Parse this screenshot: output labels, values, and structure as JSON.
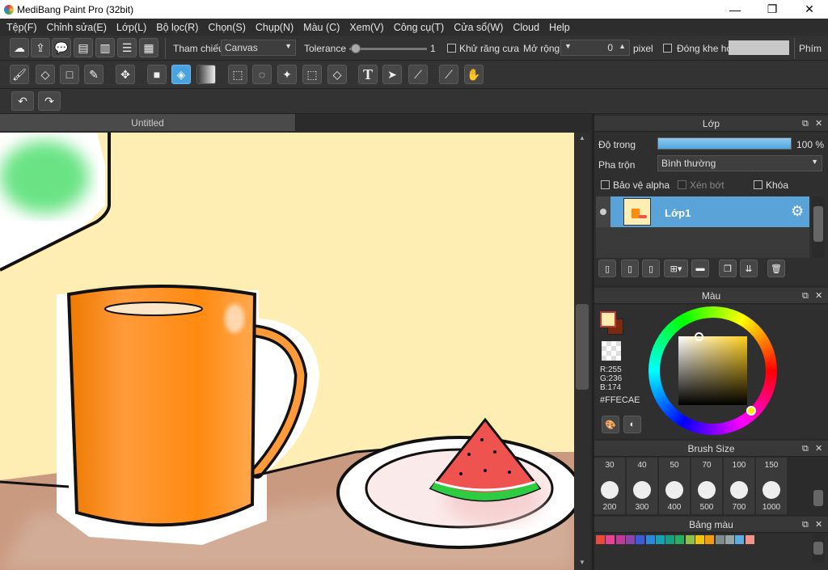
{
  "app": {
    "title": "MediBang Paint Pro (32bit)",
    "min": "—",
    "max": "❐",
    "close": "✕"
  },
  "menu": [
    "Tệp(F)",
    "Chỉnh sửa(E)",
    "Lớp(L)",
    "Bộ lọc(R)",
    "Chọn(S)",
    "Chụp(N)",
    "Màu (C)",
    "Xem(V)",
    "Công cụ(T)",
    "Cửa sổ(W)",
    "Cloud",
    "Help"
  ],
  "toolbar": {
    "reference_label": "Tham chiếu",
    "reference_value": "Canvas",
    "tolerance_label": "Tolerance",
    "tolerance_value": "1",
    "tolerance_fraction": 0.02,
    "antialias_label": "Khử răng cưa",
    "expand_label": "Mở rộng",
    "expand_value": "0",
    "pixel_label": "pixel",
    "close_gap_label": "Đóng khe hở",
    "keys_label": "Phím"
  },
  "document": {
    "tab": "Untitled"
  },
  "layers": {
    "title": "Lớp",
    "opacity_label": "Độ trong",
    "opacity_value": "100 %",
    "opacity_fraction": 1.0,
    "blend_label": "Pha trộn",
    "blend_value": "Bình thường",
    "protect_alpha": "Bảo vệ alpha",
    "clip": "Xén bớt",
    "lock": "Khóa",
    "layer_name": "Lớp1"
  },
  "color": {
    "title": "Màu",
    "r": "R:255",
    "g": "G:236",
    "b": "B:174",
    "hex": "#FFECAE",
    "fg": "#FFECAE",
    "bg": "#7a2a10"
  },
  "brush": {
    "title": "Brush Size",
    "top": [
      "30",
      "40",
      "50",
      "70",
      "100",
      "150"
    ],
    "bottom": [
      "200",
      "300",
      "400",
      "500",
      "700",
      "1000"
    ]
  },
  "palette": {
    "title": "Bảng màu",
    "swatches": [
      "#e74c3c",
      "#e84393",
      "#c0399b",
      "#8e44ad",
      "#3b5bdb",
      "#2e86de",
      "#17a2b8",
      "#16a085",
      "#27ae60",
      "#8bc34a",
      "#f1c40f",
      "#f39c12",
      "#7f8c8d",
      "#95a5a6",
      "#5dade2",
      "#f1948a"
    ]
  }
}
